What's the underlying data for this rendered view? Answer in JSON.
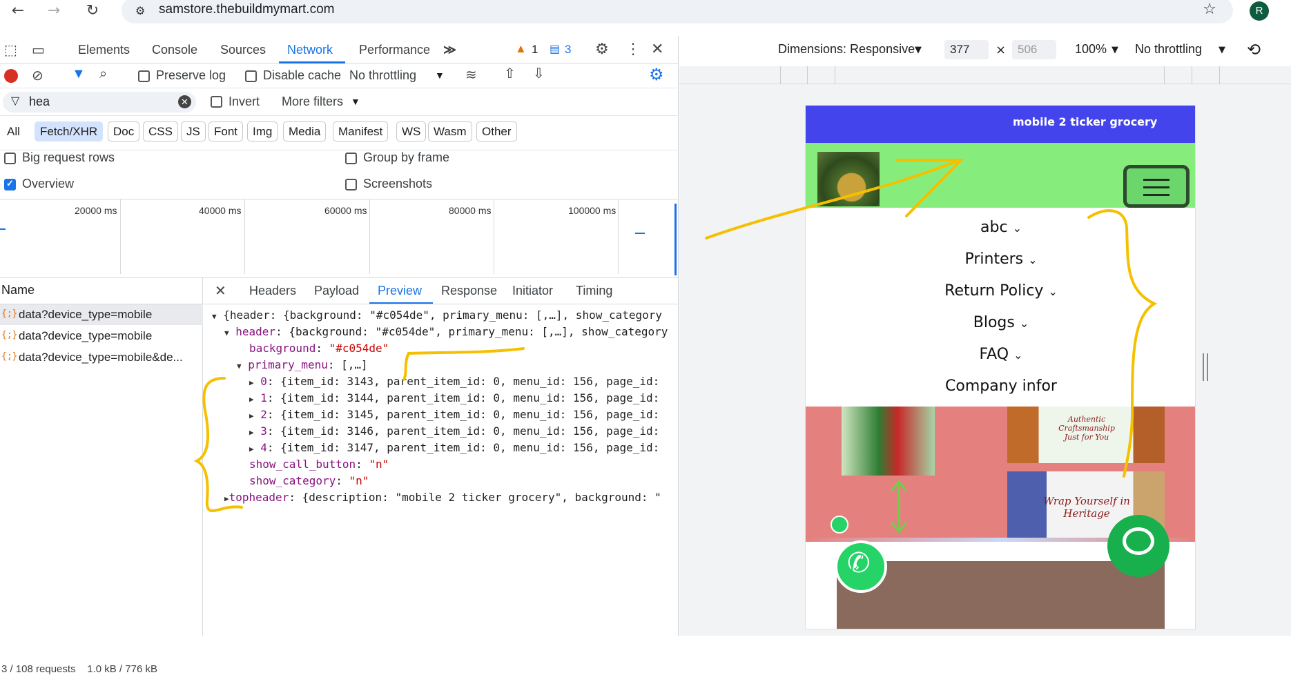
{
  "browser": {
    "url": "samstore.thebuildmymart.com",
    "profile_initial": "R"
  },
  "devtools": {
    "tabs": [
      "Elements",
      "Console",
      "Sources",
      "Network",
      "Performance"
    ],
    "active_tab": "Network",
    "warning_count": "1",
    "message_count": "3",
    "toolbar": {
      "preserve_log": "Preserve log",
      "disable_cache": "Disable cache",
      "throttling": "No throttling"
    },
    "filter": {
      "value": "hea",
      "invert": "Invert",
      "more_filters": "More filters"
    },
    "type_chips": [
      "All",
      "Fetch/XHR",
      "Doc",
      "CSS",
      "JS",
      "Font",
      "Img",
      "Media",
      "Manifest",
      "WS",
      "Wasm",
      "Other"
    ],
    "active_chip": "Fetch/XHR",
    "options": {
      "big_request_rows": "Big request rows",
      "group_by_frame": "Group by frame",
      "overview": "Overview",
      "screenshots": "Screenshots"
    },
    "timeline_ticks": [
      "20000 ms",
      "40000 ms",
      "60000 ms",
      "80000 ms",
      "100000 ms"
    ],
    "requests_header": "Name",
    "requests": [
      "data?device_type=mobile",
      "data?device_type=mobile",
      "data?device_type=mobile&de..."
    ],
    "status_bar": "3 / 108 requests    1.0 kB / 776 kB",
    "detail_tabs": [
      "Headers",
      "Payload",
      "Preview",
      "Response",
      "Initiator",
      "Timing"
    ],
    "active_detail_tab": "Preview",
    "preview": {
      "root": "{header: {background: \"#c054de\", primary_menu: [,…], show_category",
      "header_line": "{background: \"#c054de\", primary_menu: [,…], show_category",
      "background_value": "\"#c054de\"",
      "primary_menu_value": "[,…]",
      "menu_items": [
        {
          "index": "0",
          "text": "{item_id: 3143, parent_item_id: 0, menu_id: 156, page_id:"
        },
        {
          "index": "1",
          "text": "{item_id: 3144, parent_item_id: 0, menu_id: 156, page_id:"
        },
        {
          "index": "2",
          "text": "{item_id: 3145, parent_item_id: 0, menu_id: 156, page_id:"
        },
        {
          "index": "3",
          "text": "{item_id: 3146, parent_item_id: 0, menu_id: 156, page_id:"
        },
        {
          "index": "4",
          "text": "{item_id: 3147, parent_item_id: 0, menu_id: 156, page_id:"
        }
      ],
      "show_call_button_value": "\"n\"",
      "show_category_value": "\"n\"",
      "topheader_value": "{description: \"mobile 2 ticker grocery\", background: \""
    }
  },
  "device_toolbar": {
    "dimensions": "Dimensions: Responsive",
    "width": "377",
    "height": "506",
    "zoom": "100%",
    "throttling": "No throttling"
  },
  "mobile": {
    "ticker_text": "mobile 2 ticker grocery",
    "header_background": "#86ed7d",
    "ticker_background": "#4444ec",
    "menu": [
      "abc",
      "Printers",
      "Return Policy",
      "Blogs",
      "FAQ",
      "Company infor"
    ],
    "banner": {
      "caption1_line1": "Authentic Craftsmanship",
      "caption1_line2": "Just for You",
      "caption2_line1": "Wrap Yourself in",
      "caption2_line2": "Heritage"
    }
  }
}
